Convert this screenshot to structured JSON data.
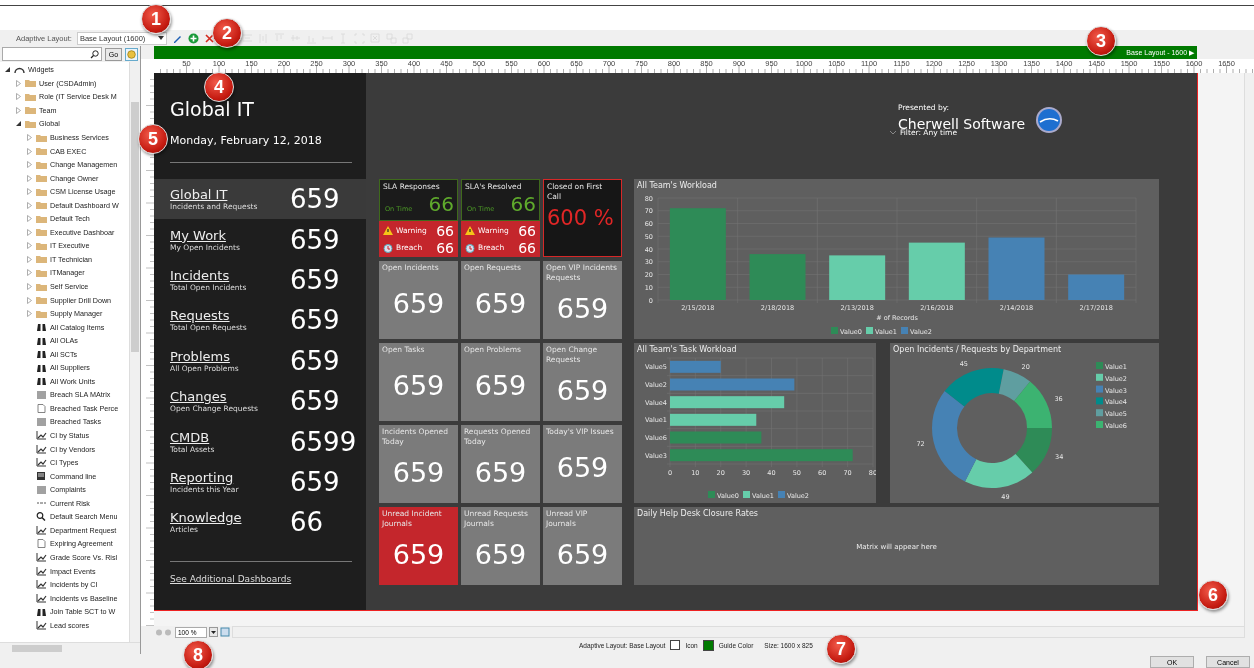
{
  "toolbar": {
    "label": "Adaptive Layout:",
    "layout_select": "Base Layout (1600)",
    "tools": [
      {
        "kind": "edit",
        "disabled": false
      },
      {
        "kind": "add",
        "disabled": false
      },
      {
        "kind": "delete",
        "disabled": false
      },
      {
        "kind": "same-width",
        "disabled": true
      },
      {
        "kind": "same-height",
        "disabled": true
      },
      {
        "kind": "align-top",
        "disabled": true
      },
      {
        "kind": "align-middle",
        "disabled": true
      },
      {
        "kind": "align-bottom",
        "disabled": true
      },
      {
        "kind": "space-horizontal",
        "disabled": true
      },
      {
        "kind": "space-vertical",
        "disabled": true
      },
      {
        "kind": "select-frame",
        "disabled": true
      },
      {
        "kind": "ungroup",
        "disabled": true
      },
      {
        "kind": "bring-forward",
        "disabled": true
      },
      {
        "kind": "send-backward",
        "disabled": true
      }
    ]
  },
  "sidebar": {
    "go_button": "Go",
    "tree": [
      {
        "label": "Widgets",
        "kind": "widgets",
        "expanded": true,
        "children": [
          {
            "label": "User (CSDAdmin)",
            "kind": "folder",
            "expanded": false
          },
          {
            "label": "Role (IT Service Desk M",
            "kind": "folder",
            "expanded": false
          },
          {
            "label": "Team",
            "kind": "folder",
            "expanded": false
          },
          {
            "label": "Global",
            "kind": "folder",
            "expanded": true,
            "children": [
              {
                "label": "Business Services",
                "kind": "folder",
                "expanded": false
              },
              {
                "label": "CAB EXEC",
                "kind": "folder",
                "expanded": false
              },
              {
                "label": "Change Managemen",
                "kind": "folder",
                "expanded": false
              },
              {
                "label": "Change Owner",
                "kind": "folder",
                "expanded": false
              },
              {
                "label": "CSM License Usage",
                "kind": "folder",
                "expanded": false
              },
              {
                "label": "Default Dashboard W",
                "kind": "folder",
                "expanded": false
              },
              {
                "label": "Default Tech",
                "kind": "folder",
                "expanded": false
              },
              {
                "label": "Executive Dashboar",
                "kind": "folder",
                "expanded": false
              },
              {
                "label": "IT Executive",
                "kind": "folder",
                "expanded": false
              },
              {
                "label": "IT Technician",
                "kind": "folder",
                "expanded": false
              },
              {
                "label": "ITManager",
                "kind": "folder",
                "expanded": false
              },
              {
                "label": "Self Service",
                "kind": "folder",
                "expanded": false
              },
              {
                "label": "Supplier Drill Down",
                "kind": "folder",
                "expanded": false
              },
              {
                "label": "Supply Manager",
                "kind": "folder",
                "expanded": false
              },
              {
                "label": "All Catalog Items",
                "kind": "find"
              },
              {
                "label": "All OLAs",
                "kind": "find"
              },
              {
                "label": "All SCTs",
                "kind": "find"
              },
              {
                "label": "All Suppliers",
                "kind": "find"
              },
              {
                "label": "All Work Units",
                "kind": "find"
              },
              {
                "label": "Breach SLA MAtrix",
                "kind": "grid"
              },
              {
                "label": "Breached Task Perce",
                "kind": "doc"
              },
              {
                "label": "Breached Tasks",
                "kind": "grid"
              },
              {
                "label": "CI by Status",
                "kind": "chart"
              },
              {
                "label": "CI by Vendors",
                "kind": "chart"
              },
              {
                "label": "CI Types",
                "kind": "chart"
              },
              {
                "label": "Command line",
                "kind": "command"
              },
              {
                "label": "Complaints",
                "kind": "grid"
              },
              {
                "label": "Current Risk",
                "kind": "line"
              },
              {
                "label": "Default Search Menu",
                "kind": "search"
              },
              {
                "label": "Department Request",
                "kind": "chart"
              },
              {
                "label": "Expiring Agreement",
                "kind": "doc"
              },
              {
                "label": "Grade Score Vs. Risl",
                "kind": "chart"
              },
              {
                "label": "Impact Events",
                "kind": "chart"
              },
              {
                "label": "Incidents by CI",
                "kind": "chart"
              },
              {
                "label": "Incidents vs Baseline",
                "kind": "chart"
              },
              {
                "label": "Join Table SCT to W",
                "kind": "find"
              },
              {
                "label": "Lead scores",
                "kind": "chart"
              }
            ]
          }
        ]
      }
    ]
  },
  "designer": {
    "guide_bar": "Base Layout - 1600 ▶",
    "ruler": [
      "50",
      "100",
      "150",
      "200",
      "250",
      "300",
      "350",
      "400",
      "450",
      "500",
      "550",
      "600",
      "650",
      "700",
      "750",
      "800",
      "850",
      "900",
      "950",
      "1000",
      "1050",
      "1100",
      "1150",
      "1200",
      "1250",
      "1300",
      "1350",
      "1400",
      "1450",
      "1500",
      "1550",
      "1600",
      "1650"
    ],
    "dashboard": {
      "title": "Global IT",
      "date": "Monday, February 12, 2018",
      "nav": [
        {
          "title": "Global IT",
          "subtitle": "Incidents and Requests",
          "count": "659",
          "selected": true
        },
        {
          "title": "My Work",
          "subtitle": "My Open Incidents",
          "count": "659",
          "selected": false
        },
        {
          "title": "Incidents",
          "subtitle": "Total Open Incidents",
          "count": "659",
          "selected": false
        },
        {
          "title": "Requests",
          "subtitle": "Total Open Requests",
          "count": "659",
          "selected": false
        },
        {
          "title": "Problems",
          "subtitle": "All Open Problems",
          "count": "659",
          "selected": false
        },
        {
          "title": "Changes",
          "subtitle": "Open Change Requests",
          "count": "659",
          "selected": false
        },
        {
          "title": "CMDB",
          "subtitle": "Total Assets",
          "count": "6599",
          "selected": false
        },
        {
          "title": "Reporting",
          "subtitle": "Incidents this Year",
          "count": "659",
          "selected": false
        },
        {
          "title": "Knowledge",
          "subtitle": "Articles",
          "count": "66",
          "selected": false
        }
      ],
      "more_link": "See Additional Dashboards",
      "presented_by": "Presented by:",
      "company": "Cherwell Software",
      "filter": "Filter: Any time",
      "tiles": [
        {
          "kind": "sla",
          "title": "SLA Responses",
          "on_time_label": "On Time",
          "on_time": "66",
          "warning_label": "Warning",
          "warning": "66",
          "breach_label": "Breach",
          "breach": "66"
        },
        {
          "kind": "sla",
          "title": "SLA's Resolved",
          "on_time_label": "On Time",
          "on_time": "66",
          "warning_label": "Warning",
          "warning": "66",
          "breach_label": "Breach",
          "breach": "66"
        },
        {
          "kind": "percent",
          "title": "Closed on First Call",
          "value": "600 %"
        },
        {
          "kind": "count",
          "title": "Open Incidents",
          "value": "659",
          "alert": false
        },
        {
          "kind": "count",
          "title": "Open Requests",
          "value": "659",
          "alert": false
        },
        {
          "kind": "count",
          "title": "Open VIP Incidents Requests",
          "value": "659",
          "alert": false
        },
        {
          "kind": "count",
          "title": "Open Tasks",
          "value": "659",
          "alert": false
        },
        {
          "kind": "count",
          "title": "Open Problems",
          "value": "659",
          "alert": false
        },
        {
          "kind": "count",
          "title": "Open Change Requests",
          "value": "659",
          "alert": false
        },
        {
          "kind": "count",
          "title": "Incidents Opened Today",
          "value": "659",
          "alert": false
        },
        {
          "kind": "count",
          "title": "Requests Opened Today",
          "value": "659",
          "alert": false
        },
        {
          "kind": "count",
          "title": "Today's VIP Issues",
          "value": "659",
          "alert": false
        },
        {
          "kind": "count",
          "title": "Unread Incident Journals",
          "value": "659",
          "alert": true
        },
        {
          "kind": "count",
          "title": "Unread Requests Journals",
          "value": "659",
          "alert": false
        },
        {
          "kind": "count",
          "title": "Unread VIP Journals",
          "value": "659",
          "alert": false
        }
      ],
      "workload": {
        "title": "All Team's Workload",
        "chart_data": {
          "type": "bar",
          "xlabel": "# of Records",
          "categories": [
            "2/15/2018",
            "2/18/2018",
            "2/13/2018",
            "2/16/2018",
            "2/14/2018",
            "2/17/2018"
          ],
          "series": [
            {
              "name": "Value0",
              "color": "#2e8b57",
              "values": [
                72,
                36,
                null,
                null,
                null,
                null
              ]
            },
            {
              "name": "Value1",
              "color": "#66cdaa",
              "values": [
                null,
                null,
                35,
                45,
                null,
                null
              ]
            },
            {
              "name": "Value2",
              "color": "#4682b4",
              "values": [
                null,
                null,
                null,
                null,
                49,
                20
              ]
            }
          ],
          "ylim": [
            0,
            80
          ],
          "yticks": [
            0,
            10,
            20,
            30,
            40,
            50,
            60,
            70,
            80
          ],
          "grid": true,
          "legend": "bottom"
        }
      },
      "task_workload": {
        "title": "All Team's Task Workload",
        "chart_data": {
          "type": "bar",
          "orientation": "horizontal",
          "categories": [
            "Value5",
            "Value2",
            "Value4",
            "Value1",
            "Value6",
            "Value3"
          ],
          "series": [
            {
              "name": "Value0",
              "color": "#2e8b57",
              "values": [
                null,
                null,
                null,
                null,
                36,
                72
              ]
            },
            {
              "name": "Value1",
              "color": "#66cdaa",
              "values": [
                null,
                null,
                45,
                34,
                null,
                null
              ]
            },
            {
              "name": "Value2",
              "color": "#4682b4",
              "values": [
                20,
                49,
                null,
                null,
                null,
                null
              ]
            }
          ],
          "xlim": [
            0,
            80
          ],
          "xticks": [
            0,
            10,
            20,
            30,
            40,
            50,
            60,
            70,
            80
          ],
          "grid": true,
          "legend": "bottom"
        }
      },
      "by_department": {
        "title": "Open Incidents / Requests by Department",
        "chart_data": {
          "type": "donut",
          "categories": [
            "Value1",
            "Value2",
            "Value3",
            "Value4",
            "Value5",
            "Value6"
          ],
          "values": [
            34,
            49,
            72,
            45,
            20,
            36
          ],
          "colors": [
            "#2e8b57",
            "#66cdaa",
            "#4682b4",
            "#008b8b",
            "#5f9ea0",
            "#3cb371"
          ],
          "data_labels": true,
          "legend": "right"
        }
      },
      "closure": {
        "title": "Daily Help Desk Closure Rates",
        "message": "Matrix will appear here"
      }
    },
    "zoom": "100 %",
    "status": {
      "layout": "Adaptive Layout: Base Layout",
      "icon_label": "Icon",
      "icon_checked": false,
      "guide_label": "Guide Color",
      "color": "#007a00",
      "size": "Size: 1600 x 825"
    }
  },
  "dialog_buttons": [
    "OK",
    "Cancel"
  ],
  "callouts": [
    "1",
    "2",
    "3",
    "4",
    "5",
    "6",
    "7",
    "8"
  ]
}
